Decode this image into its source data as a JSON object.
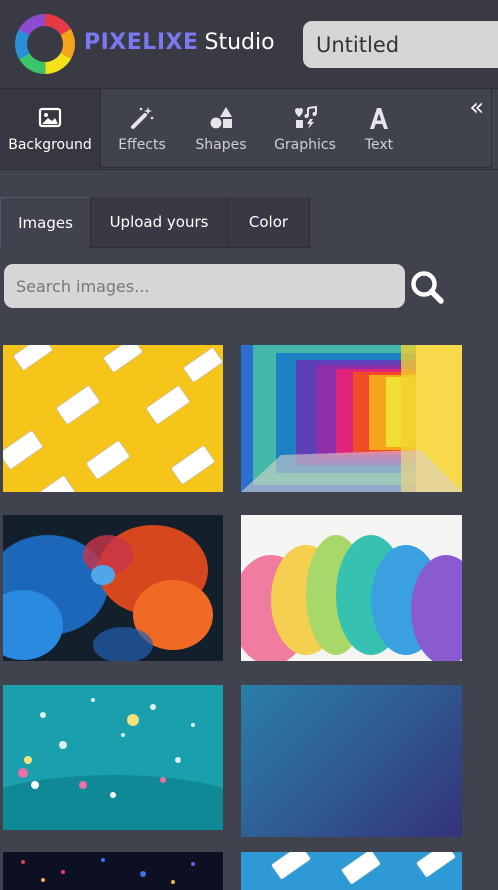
{
  "app": {
    "brand_name": "PIXELIXE",
    "brand_suffix": "Studio",
    "document_title": "Untitled"
  },
  "toolbar": {
    "tools": [
      {
        "label": "Background",
        "icon": "image-icon",
        "active": true
      },
      {
        "label": "Effects",
        "icon": "magic-wand-icon"
      },
      {
        "label": "Shapes",
        "icon": "shapes-icon"
      },
      {
        "label": "Graphics",
        "icon": "graphics-icon"
      },
      {
        "label": "Text",
        "icon": "text-a-icon"
      }
    ],
    "collapse_icon": "double-chevron-left-icon",
    "collapse_glyph": "«"
  },
  "subtabs": [
    {
      "label": "Images",
      "active": true
    },
    {
      "label": "Upload yours"
    },
    {
      "label": "Color"
    }
  ],
  "search": {
    "placeholder": "Search images...",
    "icon": "search-icon"
  },
  "images": [
    {
      "name": "yellow-boxed-water-cartons"
    },
    {
      "name": "rainbow-frame-tunnel"
    },
    {
      "name": "blue-red-ink-smoke"
    },
    {
      "name": "rainbow-powder-explosion"
    },
    {
      "name": "teal-confetti-bokeh"
    },
    {
      "name": "blue-purple-gradient"
    },
    {
      "name": "dark-city-lights"
    },
    {
      "name": "blue-boxed-water-cartons"
    }
  ],
  "colors": {
    "panel_bg": "#40424d",
    "header_bg": "#393a44",
    "brand_purple": "#7b79f2",
    "input_bg": "#d6d6d6"
  }
}
